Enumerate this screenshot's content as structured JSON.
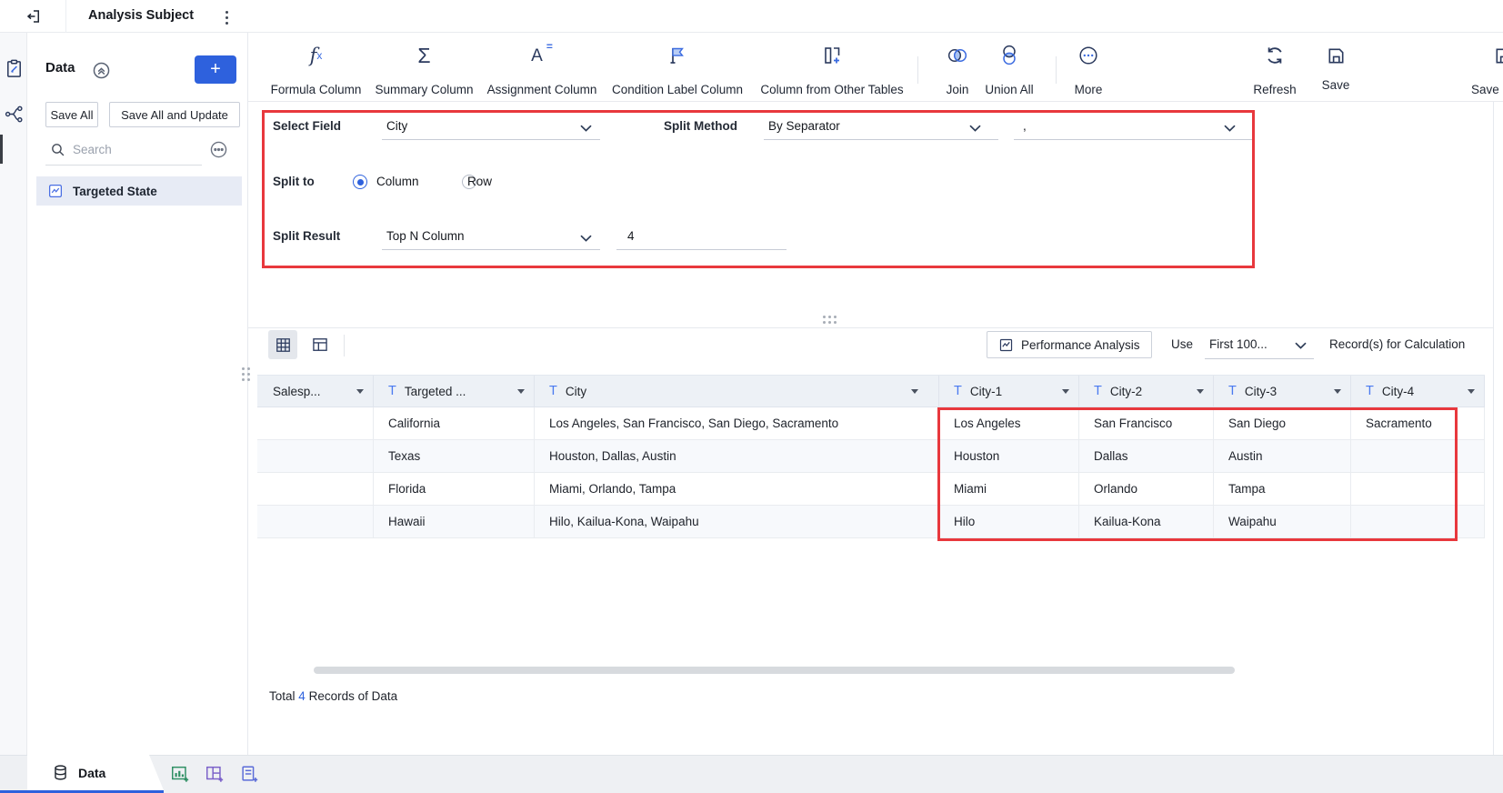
{
  "topbar": {
    "title": "Analysis Subject"
  },
  "toolbar": {
    "items": [
      {
        "label": "Formula Column"
      },
      {
        "label": "Summary Column"
      },
      {
        "label": "Assignment Column"
      },
      {
        "label": "Condition Label Column"
      },
      {
        "label": "Column from Other Tables"
      },
      {
        "label": "Join"
      },
      {
        "label": "Union All"
      },
      {
        "label": "More"
      }
    ],
    "refresh_label": "Refresh",
    "save_label": "Save",
    "save_and_label": "Save and"
  },
  "sidebar": {
    "title": "Data",
    "add_label": "+",
    "save_all_label": "Save All",
    "save_all_update_label": "Save All and Update",
    "search_placeholder": "Search",
    "items": [
      {
        "label": "Targeted State"
      }
    ]
  },
  "form": {
    "select_field": {
      "label": "Select Field",
      "value": "City"
    },
    "split_method": {
      "label": "Split Method",
      "value": "By Separator"
    },
    "separator": {
      "value": ","
    },
    "split_to": {
      "label": "Split to",
      "option_column": "Column",
      "option_row": "Row",
      "selected": "Column"
    },
    "split_result": {
      "label": "Split Result",
      "value": "Top N Column",
      "n_value": "4"
    }
  },
  "view_controls": {
    "performance_label": "Performance Analysis",
    "use_label": "Use",
    "records_dropdown_value": "First 100...",
    "records_suffix": "Record(s) for Calculation"
  },
  "table": {
    "columns": [
      {
        "label": "Salesp..."
      },
      {
        "label": "Targeted ..."
      },
      {
        "label": "City"
      },
      {
        "label": "City-1"
      },
      {
        "label": "City-2"
      },
      {
        "label": "City-3"
      },
      {
        "label": "City-4"
      }
    ],
    "rows": [
      [
        "",
        "California",
        "Los Angeles, San Francisco, San Diego, Sacramento",
        "Los Angeles",
        "San Francisco",
        "San Diego",
        "Sacramento"
      ],
      [
        "",
        "Texas",
        "Houston, Dallas, Austin",
        "Houston",
        "Dallas",
        "Austin",
        ""
      ],
      [
        "",
        "Florida",
        "Miami, Orlando, Tampa",
        "Miami",
        "Orlando",
        "Tampa",
        ""
      ],
      [
        "",
        "Hawaii",
        "Hilo, Kailua-Kona, Waipahu",
        "Hilo",
        "Kailua-Kona",
        "Waipahu",
        ""
      ]
    ]
  },
  "footer": {
    "total_prefix": "Total",
    "total_count": "4",
    "total_suffix": "Records of Data"
  },
  "tabs": {
    "data_label": "Data"
  },
  "icons": {
    "formula": "fx",
    "summary": "Σ",
    "assignment": "A=",
    "column_type": "T",
    "kebab": "⋮",
    "more": "⋯",
    "accent_color": "#3b6be0",
    "primary_color": "#2e61dd",
    "highlight_color": "#e8383d"
  }
}
